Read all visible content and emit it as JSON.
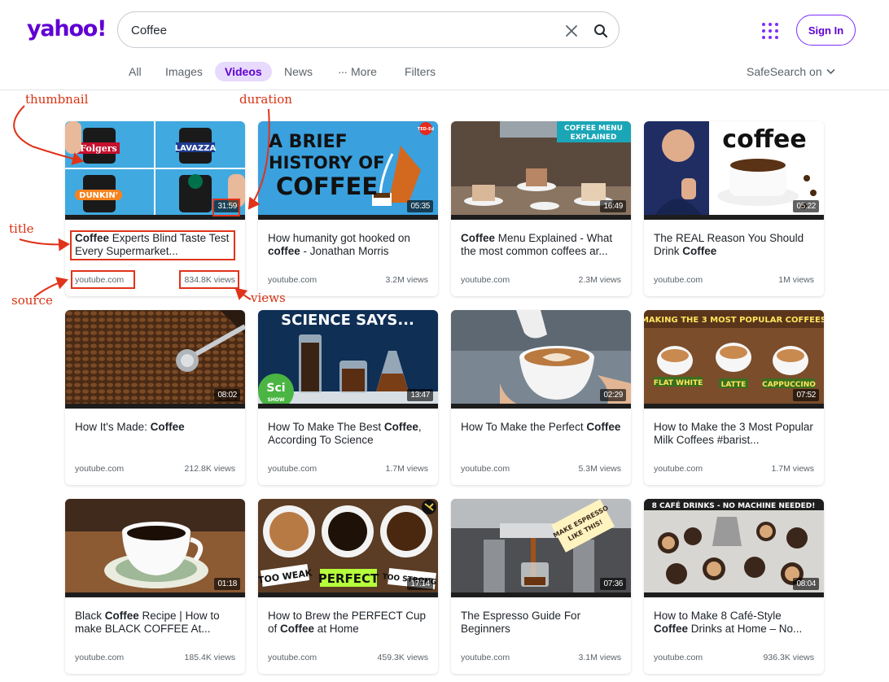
{
  "header": {
    "logo": "yahoo!",
    "search_value": "Coffee",
    "sign_in_label": "Sign In"
  },
  "nav": {
    "tabs": [
      {
        "label": "All",
        "active": false
      },
      {
        "label": "Images",
        "active": false
      },
      {
        "label": "Videos",
        "active": true
      },
      {
        "label": "News",
        "active": false
      },
      {
        "label": "More",
        "active": false
      },
      {
        "label": "Filters",
        "active": false
      }
    ],
    "safesearch": "SafeSearch on"
  },
  "annotations": {
    "thumbnail": "thumbnail",
    "duration": "duration",
    "title": "title",
    "source": "source",
    "views": "views"
  },
  "colors": {
    "brand": "#6001d2",
    "annotation": "#d83113"
  },
  "results": [
    {
      "title_html": "<b>Coffee</b> Experts Blind Taste Test Every Supermarket...",
      "duration": "31:59",
      "source": "youtube.com",
      "views": "834.8K views"
    },
    {
      "title_html": "How humanity got hooked on <b>coffee</b> - Jonathan Morris",
      "duration": "05:35",
      "source": "youtube.com",
      "views": "3.2M views"
    },
    {
      "title_html": "<b>Coffee</b> Menu Explained - What the most common coffees ar...",
      "duration": "16:49",
      "source": "youtube.com",
      "views": "2.3M views"
    },
    {
      "title_html": "The REAL Reason You Should Drink <b>Coffee</b>",
      "duration": "05:22",
      "source": "youtube.com",
      "views": "1M views"
    },
    {
      "title_html": "How It's Made: <b>Coffee</b>",
      "duration": "08:02",
      "source": "youtube.com",
      "views": "212.8K views"
    },
    {
      "title_html": "How To Make The Best <b>Coffee</b>, According To Science",
      "duration": "13:47",
      "source": "youtube.com",
      "views": "1.7M views"
    },
    {
      "title_html": "How To Make the Perfect <b>Coffee</b>",
      "duration": "02:29",
      "source": "youtube.com",
      "views": "5.3M views"
    },
    {
      "title_html": "How to Make the 3 Most Popular Milk Coffees #barist...",
      "duration": "07:52",
      "source": "youtube.com",
      "views": "1.7M views"
    },
    {
      "title_html": "Black <b>Coffee</b> Recipe | How to make BLACK COFFEE At...",
      "duration": "01:18",
      "source": "youtube.com",
      "views": "185.4K views"
    },
    {
      "title_html": "How to Brew the PERFECT Cup of <b>Coffee</b> at Home",
      "duration": "17:14",
      "source": "youtube.com",
      "views": "459.3K views"
    },
    {
      "title_html": "The Espresso Guide For Beginners",
      "duration": "07:36",
      "source": "youtube.com",
      "views": "3.1M views"
    },
    {
      "title_html": "How to Make 8 Café-Style <b>Coffee</b> Drinks at Home – No...",
      "duration": "08:04",
      "source": "youtube.com",
      "views": "936.3K views"
    }
  ],
  "thumb_text": {
    "t1": [
      "Folgers",
      "LAVAZZA",
      "DUNKIN'"
    ],
    "t2": [
      "A BRIEF",
      "HISTORY OF",
      "COFFEE",
      "TED-Ed"
    ],
    "t3": [
      "COFFEE MENU",
      "EXPLAINED"
    ],
    "t4": [
      "coffee"
    ],
    "t6": [
      "SCIENCE SAYS...",
      "Sci",
      "SHOW"
    ],
    "t8": [
      "MAKING THE 3 MOST POPULAR COFFEES",
      "FLAT WHITE",
      "LATTE",
      "CAPPUCCINO"
    ],
    "t10": [
      "TOO WEAK",
      "PERFECT",
      "TOO STRONG"
    ],
    "t11": [
      "MAKE ESPRESSO",
      "LIKE THIS!"
    ],
    "t12": [
      "8 CAFÉ DRINKS - NO MACHINE NEEDED!"
    ]
  }
}
